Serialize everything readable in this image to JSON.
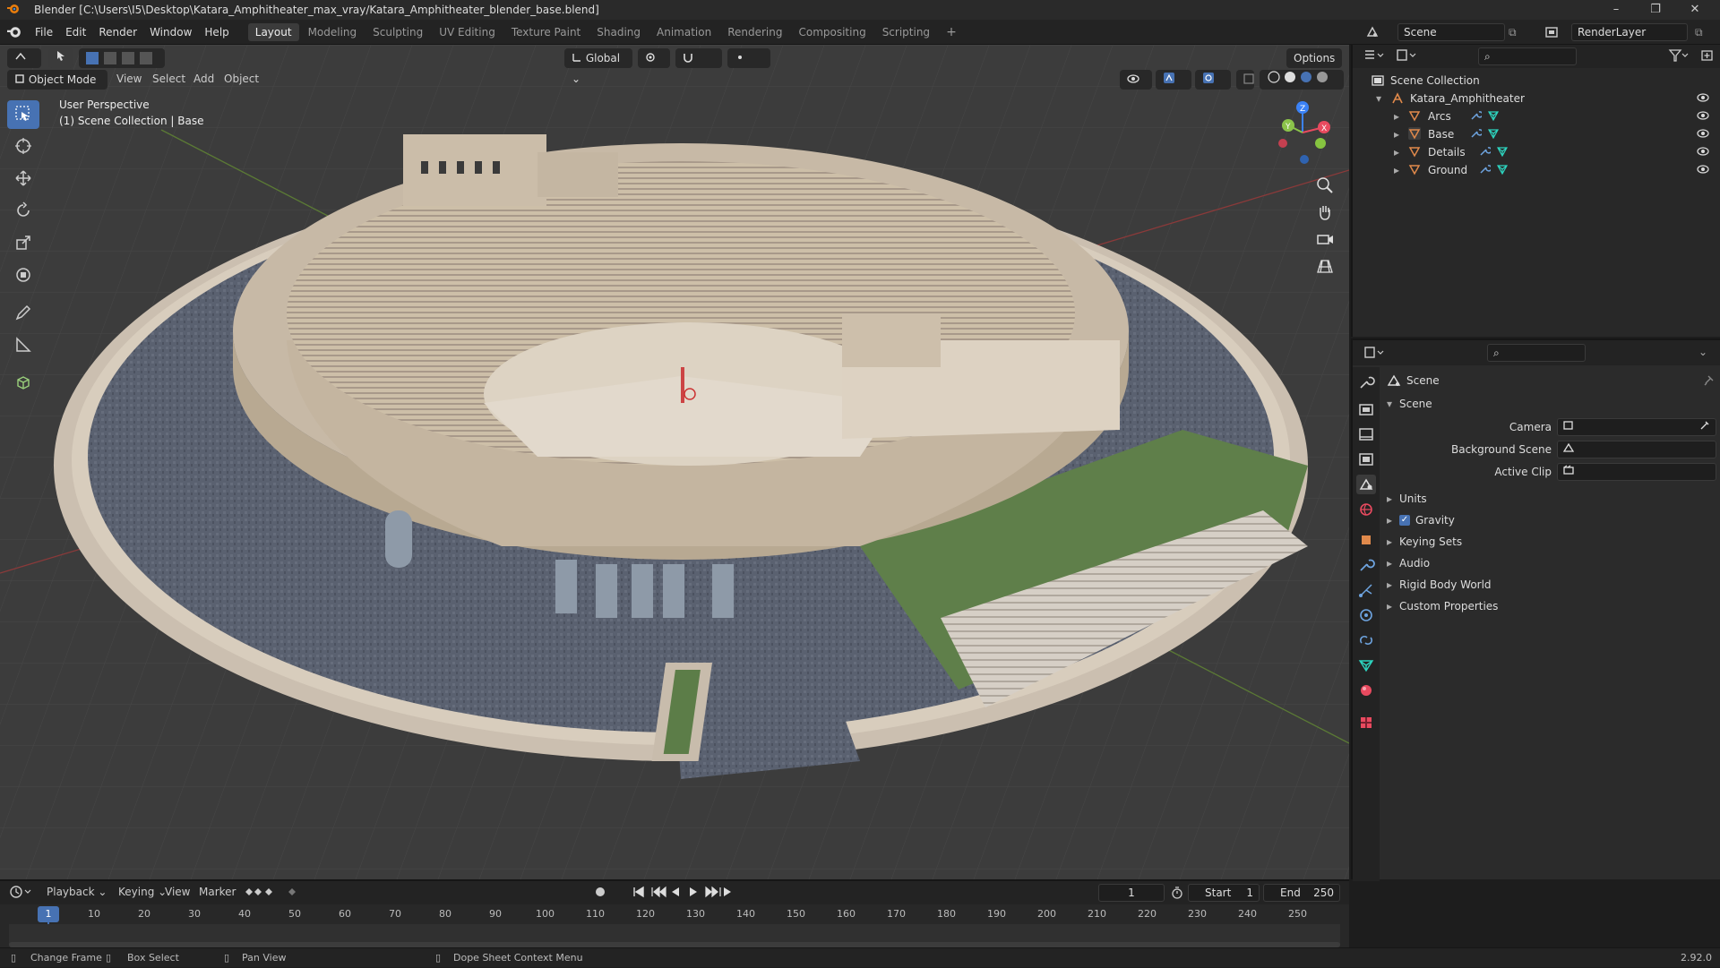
{
  "window": {
    "title": "Blender [C:\\Users\\I5\\Desktop\\Katara_Amphitheater_max_vray/Katara_Amphitheater_blender_base.blend]",
    "controls": [
      "–",
      "❐",
      "✕"
    ]
  },
  "menu": {
    "items": [
      "File",
      "Edit",
      "Render",
      "Window",
      "Help"
    ]
  },
  "workspaces": {
    "tabs": [
      "Layout",
      "Modeling",
      "Sculpting",
      "UV Editing",
      "Texture Paint",
      "Shading",
      "Animation",
      "Rendering",
      "Compositing",
      "Scripting"
    ],
    "active": "Layout",
    "add": "+"
  },
  "scene_selector": {
    "scene": "Scene",
    "render_layer": "RenderLayer"
  },
  "viewport": {
    "mode": "Object Mode",
    "menus": [
      "View",
      "Select",
      "Add",
      "Object"
    ],
    "orientation": "Global",
    "options_label": "Options",
    "overlay_text": {
      "line1": "User Perspective",
      "line2": "(1) Scene Collection | Base"
    },
    "gizmo_axes": {
      "x": "X",
      "y": "Y",
      "z": "Z"
    }
  },
  "outliner": {
    "root": "Scene Collection",
    "collection": "Katara_Amphitheater",
    "objects": [
      "Arcs",
      "Base",
      "Details",
      "Ground"
    ]
  },
  "properties": {
    "header": "Scene",
    "panel_title": "Scene",
    "fields": [
      {
        "label": "Camera",
        "value": ""
      },
      {
        "label": "Background Scene",
        "value": ""
      },
      {
        "label": "Active Clip",
        "value": ""
      }
    ],
    "sections": [
      "Units",
      "Gravity",
      "Keying Sets",
      "Audio",
      "Rigid Body World",
      "Custom Properties"
    ],
    "gravity_checked": true
  },
  "timeline": {
    "menus": [
      "Playback",
      "Keying",
      "View",
      "Marker"
    ],
    "current_frame": "1",
    "start_label": "Start",
    "start_value": "1",
    "end_label": "End",
    "end_value": "250",
    "ruler": [
      "1",
      "10",
      "20",
      "30",
      "40",
      "50",
      "60",
      "70",
      "80",
      "90",
      "100",
      "110",
      "120",
      "130",
      "140",
      "150",
      "160",
      "170",
      "180",
      "190",
      "200",
      "210",
      "220",
      "230",
      "240",
      "250"
    ]
  },
  "statusbar": {
    "items": [
      "Change Frame",
      "Box Select",
      "Pan View",
      "Dope Sheet Context Menu"
    ],
    "version": "2.92.0"
  },
  "colors": {
    "accent": "#4772b3",
    "x_axis": "#e84a5f",
    "y_axis": "#8bc34a",
    "z_axis": "#3b82f6",
    "obj_icon": "#e0894b",
    "mesh_icon": "#2dd4bf"
  }
}
